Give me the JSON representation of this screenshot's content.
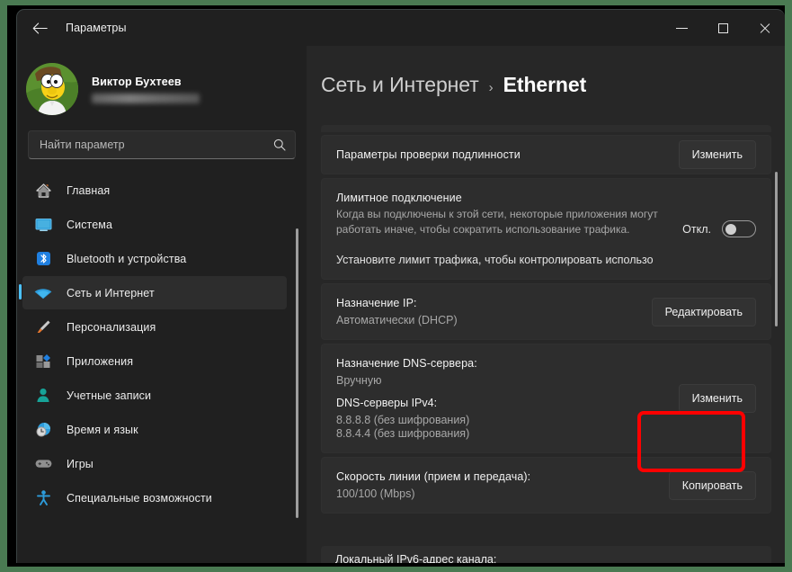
{
  "colors": {
    "desktop_green": "#4a7a52",
    "window_bg": "#202020",
    "main_bg": "#272727",
    "card_bg": "#2d2d2d",
    "accent_blue": "#4cc2ff",
    "annotation_red": "#ff0000"
  },
  "titlebar": {
    "back_label": "Назад",
    "title": "Параметры",
    "minimize_label": "Свернуть",
    "maximize_label": "Развернуть",
    "close_label": "Закрыть"
  },
  "account": {
    "name": "Виктор Бухтеев",
    "email_masked": ""
  },
  "search": {
    "placeholder": "Найти параметр",
    "value": ""
  },
  "sidebar": {
    "items": [
      {
        "label": "Главная",
        "icon": "home-icon",
        "selected": false
      },
      {
        "label": "Система",
        "icon": "system-icon",
        "selected": false
      },
      {
        "label": "Bluetooth и устройства",
        "icon": "bluetooth-icon",
        "selected": false
      },
      {
        "label": "Сеть и Интернет",
        "icon": "network-icon",
        "selected": true
      },
      {
        "label": "Персонализация",
        "icon": "brush-icon",
        "selected": false
      },
      {
        "label": "Приложения",
        "icon": "apps-icon",
        "selected": false
      },
      {
        "label": "Учетные записи",
        "icon": "account-icon",
        "selected": false
      },
      {
        "label": "Время и язык",
        "icon": "clock-icon",
        "selected": false
      },
      {
        "label": "Игры",
        "icon": "gamepad-icon",
        "selected": false
      },
      {
        "label": "Специальные возможности",
        "icon": "accessibility-icon",
        "selected": false
      }
    ]
  },
  "breadcrumb": {
    "parent": "Сеть и Интернет",
    "separator": "›",
    "current": "Ethernet"
  },
  "cards": {
    "auth": {
      "title": "Параметры проверки подлинности",
      "button": "Изменить"
    },
    "metered": {
      "title": "Лимитное подключение",
      "description": "Когда вы подключены к этой сети, некоторые приложения могут работать иначе, чтобы сократить использование трафика.",
      "note": "Установите лимит трафика, чтобы контролировать использо",
      "toggle_label": "Откл.",
      "toggle_state": "off"
    },
    "ip": {
      "title": "Назначение IP:",
      "value": "Автоматически (DHCP)",
      "button": "Редактировать"
    },
    "dns": {
      "title": "Назначение DNS-сервера:",
      "value": "Вручную",
      "servers_title": "DNS-серверы IPv4:",
      "servers": [
        "8.8.8.8 (без шифрования)",
        "8.8.4.4 (без шифрования)"
      ],
      "button": "Изменить",
      "highlighted": true
    },
    "speed": {
      "title": "Скорость линии (прием и передача):",
      "value": "100/100 (Mbps)",
      "button": "Копировать"
    },
    "cutoff": {
      "title": "Локальный IPv6-адрес канала:"
    }
  }
}
